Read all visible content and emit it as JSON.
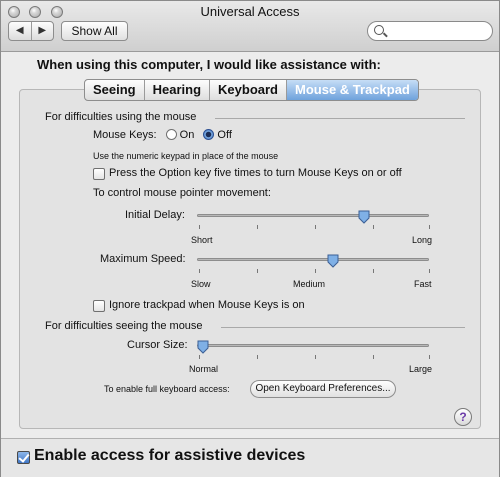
{
  "window": {
    "title": "Universal Access"
  },
  "toolbar": {
    "back_glyph": "◀",
    "forward_glyph": "▶",
    "show_all_label": "Show All",
    "search": {
      "placeholder": "",
      "value": ""
    }
  },
  "heading": "When using this computer, I would like assistance with:",
  "tabs": [
    {
      "label": "Seeing",
      "selected": false
    },
    {
      "label": "Hearing",
      "selected": false
    },
    {
      "label": "Keyboard",
      "selected": false
    },
    {
      "label": "Mouse & Trackpad",
      "selected": true
    }
  ],
  "mouse_section": {
    "title": "For difficulties using the mouse",
    "mouse_keys_label": "Mouse Keys:",
    "on_label": "On",
    "off_label": "Off",
    "mouse_keys_selected": "Off",
    "numeric_hint": "Use the numeric keypad in place of the mouse",
    "option_key_label": "Press the Option key five times to turn Mouse Keys on or off",
    "option_key_checked": false,
    "control_label": "To control mouse pointer movement:",
    "initial_delay": {
      "label": "Initial Delay:",
      "min_label": "Short",
      "max_label": "Long",
      "value": 0.73
    },
    "max_speed": {
      "label": "Maximum Speed:",
      "min_label": "Slow",
      "mid_label": "Medium",
      "max_label": "Fast",
      "value": 0.59
    },
    "ignore_trackpad_label": "Ignore trackpad when Mouse Keys is on",
    "ignore_trackpad_checked": false
  },
  "seeing_section": {
    "title": "For difficulties seeing the mouse",
    "cursor_size": {
      "label": "Cursor Size:",
      "min_label": "Normal",
      "max_label": "Large",
      "value": 0.0
    },
    "keyboard_access_label": "To enable full keyboard access:",
    "keyboard_prefs_button": "Open Keyboard Preferences..."
  },
  "help_label": "?",
  "assistive": {
    "label": "Enable access for assistive devices",
    "checked": true
  },
  "colors": {
    "accent": "#6fa2dc",
    "panel": "#e3e3e3"
  }
}
